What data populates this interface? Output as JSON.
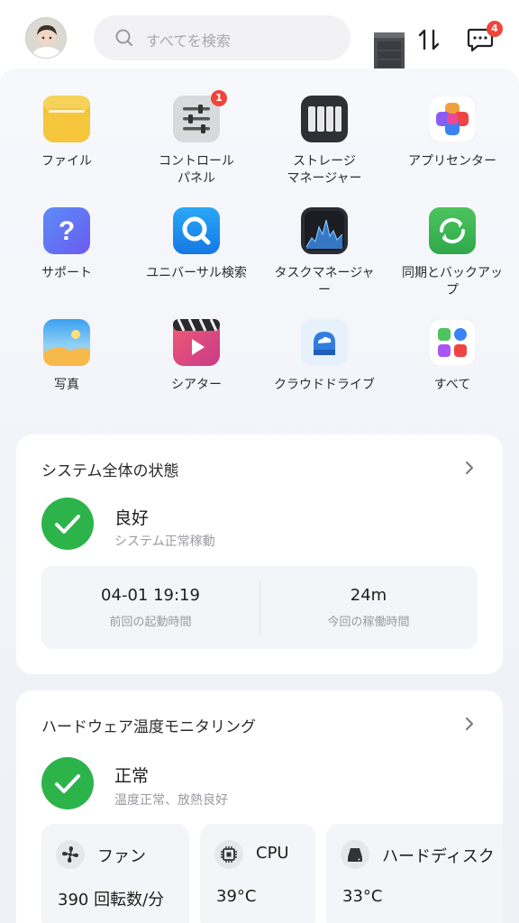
{
  "header": {
    "search_placeholder": "すべてを検索",
    "message_count": "4"
  },
  "apps": [
    {
      "label": "ファイル",
      "icon": "folder-icon"
    },
    {
      "label": "コントロール\nパネル",
      "icon": "sliders-icon",
      "badge": "1"
    },
    {
      "label": "ストレージ\nマネージャー",
      "icon": "storage-icon"
    },
    {
      "label": "アプリセンター",
      "icon": "app-center-icon"
    },
    {
      "label": "サポート",
      "icon": "question-icon"
    },
    {
      "label": "ユニバーサル検索",
      "icon": "universal-search-icon"
    },
    {
      "label": "タスクマネージャ\nー",
      "icon": "task-manager-icon"
    },
    {
      "label": "同期とバックアッ\nプ",
      "icon": "sync-icon"
    },
    {
      "label": "写真",
      "icon": "photo-icon"
    },
    {
      "label": "シアター",
      "icon": "theater-icon"
    },
    {
      "label": "クラウドドライブ",
      "icon": "cloud-drive-icon"
    },
    {
      "label": "すべて",
      "icon": "all-apps-icon"
    }
  ],
  "system_status": {
    "title": "システム全体の状態",
    "status": "良好",
    "status_desc": "システム正常稼動",
    "last_boot_value": "04-01 19:19",
    "last_boot_label": "前回の起動時間",
    "uptime_value": "24m",
    "uptime_label": "今回の稼働時間"
  },
  "hardware": {
    "title": "ハードウェア温度モニタリング",
    "status": "正常",
    "status_desc": "温度正常、放熱良好",
    "tiles": [
      {
        "name": "ファン",
        "value": "390 回転数/分",
        "icon": "fan-icon"
      },
      {
        "name": "CPU",
        "value": "39°C",
        "icon": "cpu-icon"
      },
      {
        "name": "ハードディスク",
        "value": "33°C",
        "icon": "disk-icon"
      }
    ]
  },
  "colors": {
    "accent_green": "#2cb34a",
    "badge_red": "#f0453a"
  }
}
